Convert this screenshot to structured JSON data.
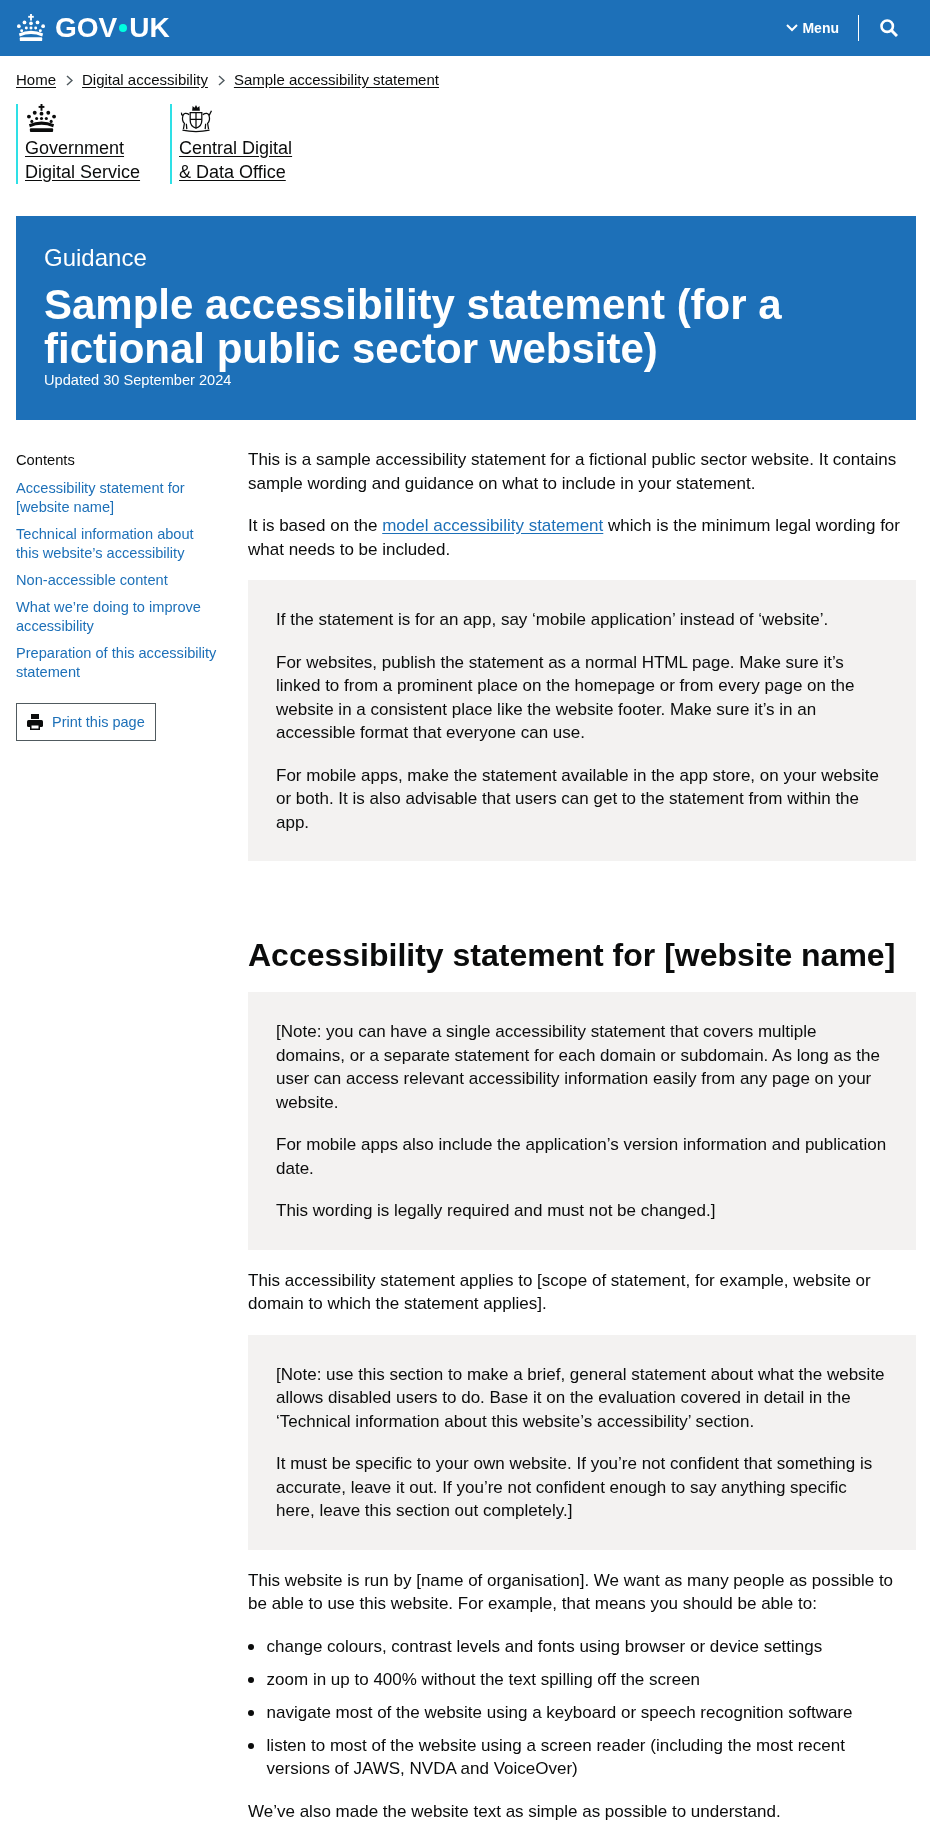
{
  "header": {
    "logo": [
      "GOV",
      "UK"
    ],
    "menu": "Menu"
  },
  "breadcrumbs": [
    "Home",
    "Digital accessibility",
    "Sample accessibility statement"
  ],
  "organisations": [
    {
      "name_lines": [
        "Government",
        "Digital Service"
      ]
    },
    {
      "name_lines": [
        "Central Digital",
        "& Data Office"
      ]
    }
  ],
  "banner": {
    "context": "Guidance",
    "title": "Sample accessibility statement (for a fictional public sector website)",
    "updated": "Updated 30 September 2024"
  },
  "contents": {
    "heading": "Contents",
    "links": [
      "Accessibility statement for [website name]",
      "Technical information about this website’s accessibility",
      "Non-accessible content",
      "What we’re doing to improve accessibility",
      "Preparation of this accessibility statement"
    ]
  },
  "print_button": "Print this page",
  "body": [
    {
      "kind": "paragraph",
      "parts": [
        {
          "kind": "text",
          "text": "This is a sample accessibility statement for a fictional public sector website. It contains sample wording and guidance on what to include in your statement."
        }
      ]
    },
    {
      "kind": "paragraph",
      "parts": [
        {
          "kind": "text",
          "text": "It is based on the "
        },
        {
          "kind": "link",
          "text": "model accessibility statement"
        },
        {
          "kind": "text",
          "text": " which is the minimum legal wording for what needs to be included."
        }
      ]
    },
    {
      "kind": "inset",
      "paragraphs": [
        "If the statement is for an app, say ‘mobile application’ instead of ‘website’.",
        "For websites, publish the statement as a normal HTML page. Make sure it’s linked to from a prominent place on the homepage or from every page on the website in a consistent place like the website footer. Make sure it’s in an accessible format that everyone can use.",
        "For mobile apps, make the statement available in the app store, on your website or both. It is also advisable that users can get to the statement from within the app."
      ]
    },
    {
      "kind": "heading",
      "text": "Accessibility statement for [website name]"
    },
    {
      "kind": "inset",
      "paragraphs": [
        "[Note: you can have a single accessibility statement that covers multiple domains, or a separate statement for each domain or subdomain. As long as the user can access relevant accessibility information easily from any page on your website.",
        "For mobile apps also include the application’s version information and publication date.",
        "This wording is legally required and must not be changed.]"
      ]
    },
    {
      "kind": "paragraph",
      "parts": [
        {
          "kind": "text",
          "text": "This accessibility statement applies to [scope of statement, for example, website or domain to which the statement applies]."
        }
      ]
    },
    {
      "kind": "inset",
      "paragraphs": [
        "[Note: use this section to make a brief, general statement about what the website allows disabled users to do. Base it on the evaluation covered in detail in the ‘Technical information about this website’s accessibility’ section.",
        "It must be specific to your own website. If you’re not confident that something is accurate, leave it out. If you’re not confident enough to say anything specific here, leave this section out completely.]"
      ]
    },
    {
      "kind": "paragraph",
      "parts": [
        {
          "kind": "text",
          "text": "This website is run by [name of organisation]. We want as many people as possible to be able to use this website. For example, that means you should be able to:"
        }
      ]
    },
    {
      "kind": "bullets",
      "items": [
        "change colours, contrast levels and fonts using browser or device settings",
        "zoom in up to 400% without the text spilling off the screen",
        "navigate most of the website using a keyboard or speech recognition software",
        "listen to most of the website using a screen reader (including the most recent versions of JAWS, NVDA and VoiceOver)"
      ]
    },
    {
      "kind": "paragraph",
      "parts": [
        {
          "kind": "text",
          "text": "We’ve also made the website text as simple as possible to understand."
        }
      ]
    }
  ]
}
